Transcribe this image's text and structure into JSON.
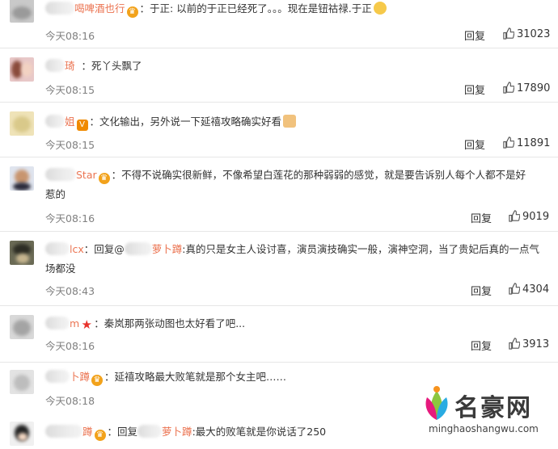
{
  "comments": [
    {
      "username": "喝啤酒也行",
      "text": "于正: 以前的于正已经死了。。。现在是钮祜禄.于正",
      "time": "今天08:16",
      "reply_label": "回复",
      "likes": "31023"
    },
    {
      "username": "琦",
      "text": "死丫头飘了",
      "time": "今天08:15",
      "reply_label": "回复",
      "likes": "17890"
    },
    {
      "username": "姐",
      "text": "文化输出，另外说一下延禧攻略确实好看",
      "time": "今天08:15",
      "reply_label": "回复",
      "likes": "11891"
    },
    {
      "username": "Star",
      "text_line1": "不得不说确实很新鲜，不像希望白莲花的那种弱弱的感觉，就是要告诉别人每个人都不是好",
      "text_line2": "惹的",
      "time": "今天08:16",
      "reply_label": "回复",
      "likes": "9019"
    },
    {
      "username": "lcx",
      "reply_prefix": "回复@",
      "reply_target": "萝卜蹲",
      "text_line1": ":真的只是女主人设讨喜，演员演技确实一般，演神空洞，当了贵妃后真的一点气",
      "text_line2": "场都没",
      "time": "今天08:43",
      "reply_label": "回复",
      "likes": "4304"
    },
    {
      "username": "m",
      "text": "秦岚那两张动图也太好看了吧...",
      "time": "今天08:16",
      "reply_label": "回复",
      "likes": "3913"
    },
    {
      "username": "卜蹲",
      "text": "延禧攻略最大败笔就是那个女主吧……",
      "time": "今天08:18",
      "reply_label": "回复",
      "likes": ""
    },
    {
      "username": "蹲",
      "reply_prefix": "回复",
      "reply_target": "萝卜蹲",
      "text": ":最大的败笔就是你说话了250"
    }
  ],
  "watermark": {
    "title": "名豪网",
    "url": "minghaoshangwu.com"
  },
  "colors": {
    "username": "#eb7350",
    "time": "#808080",
    "divider": "#e6e6e6"
  }
}
